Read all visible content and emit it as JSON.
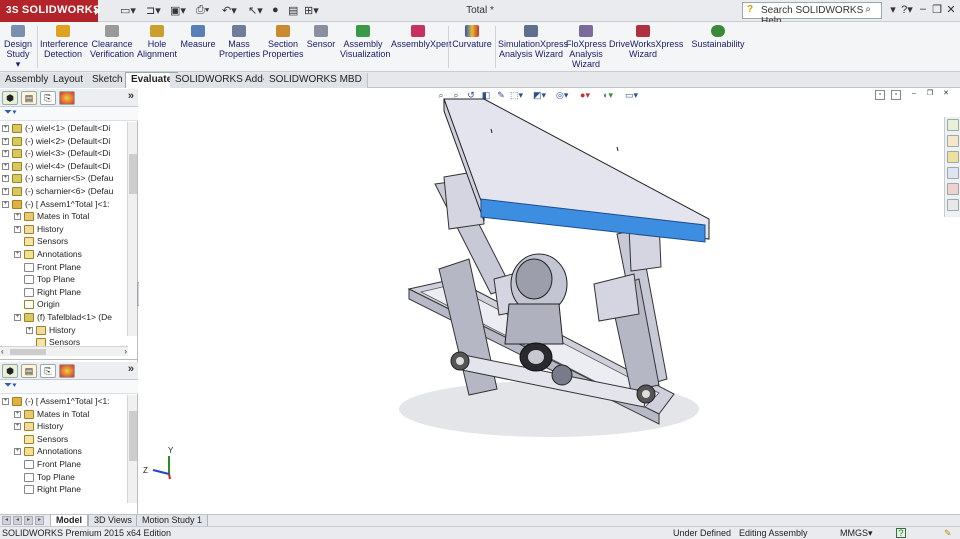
{
  "titlebar": {
    "app_name": "SOLIDWORKS",
    "brand_prefix": "3S",
    "document_title": "Total *",
    "search_placeholder": "Search SOLIDWORKS Help",
    "brand_color": "#b3242a"
  },
  "ribbon": {
    "items": [
      {
        "label": "Design Study",
        "icon": "design-study-icon"
      },
      {
        "label": "Interference Detection",
        "icon": "interference-detection-icon"
      },
      {
        "label": "Clearance Verification",
        "icon": "clearance-verification-icon"
      },
      {
        "label": "Hole Alignment",
        "icon": "hole-alignment-icon"
      },
      {
        "label": "Measure",
        "icon": "measure-icon"
      },
      {
        "label": "Mass Properties",
        "icon": "mass-properties-icon"
      },
      {
        "label": "Section Properties",
        "icon": "section-properties-icon"
      },
      {
        "label": "Sensor",
        "icon": "sensor-icon"
      },
      {
        "label": "Assembly Visualization",
        "icon": "assembly-visualization-icon"
      },
      {
        "label": "AssemblyXpert",
        "icon": "assemblyxpert-icon"
      },
      {
        "label": "Curvature",
        "icon": "curvature-icon"
      },
      {
        "label": "SimulationXpress Analysis Wizard",
        "icon": "simulationxpress-icon"
      },
      {
        "label": "FloXpress Analysis Wizard",
        "icon": "floxpress-icon"
      },
      {
        "label": "DriveWorksXpress Wizard",
        "icon": "driveworksxpress-icon"
      },
      {
        "label": "Sustainability",
        "icon": "sustainability-icon"
      }
    ]
  },
  "command_tabs": [
    "Assembly",
    "Layout",
    "Sketch",
    "Evaluate",
    "SOLIDWORKS Add-Ins",
    "SOLIDWORKS MBD"
  ],
  "active_command_tab": "Evaluate",
  "tree_top": {
    "rows": [
      {
        "label": "(-) wiel<1> (Default<Di",
        "type": "part"
      },
      {
        "label": "(-) wiel<2> (Default<Di",
        "type": "part"
      },
      {
        "label": "(-) wiel<3> (Default<Di",
        "type": "part"
      },
      {
        "label": "(-) wiel<4> (Default<Di",
        "type": "part"
      },
      {
        "label": "(-) scharnier<5> (Defau",
        "type": "part"
      },
      {
        "label": "(-) scharnier<6> (Defau",
        "type": "part"
      },
      {
        "label": "(-) [ Assem1^Total ]<1:",
        "type": "assembly"
      },
      {
        "label": "Mates in Total",
        "type": "mates"
      },
      {
        "label": "History",
        "type": "history"
      },
      {
        "label": "Sensors",
        "type": "sensors"
      },
      {
        "label": "Annotations",
        "type": "annotations"
      },
      {
        "label": "Front Plane",
        "type": "plane"
      },
      {
        "label": "Top Plane",
        "type": "plane"
      },
      {
        "label": "Right Plane",
        "type": "plane"
      },
      {
        "label": "Origin",
        "type": "origin"
      },
      {
        "label": "(f) Tafelblad<1> (De",
        "type": "part"
      },
      {
        "label": "History",
        "type": "history"
      },
      {
        "label": "Sensors",
        "type": "sensors"
      }
    ]
  },
  "tree_bottom": {
    "rows": [
      {
        "label": "(-) [ Assem1^Total ]<1:",
        "type": "assembly"
      },
      {
        "label": "Mates in Total",
        "type": "mates"
      },
      {
        "label": "History",
        "type": "history"
      },
      {
        "label": "Sensors",
        "type": "sensors"
      },
      {
        "label": "Annotations",
        "type": "annotations"
      },
      {
        "label": "Front Plane",
        "type": "plane"
      },
      {
        "label": "Top Plane",
        "type": "plane"
      },
      {
        "label": "Right Plane",
        "type": "plane"
      }
    ]
  },
  "triad": {
    "x": "X",
    "y": "Y",
    "z": "Z"
  },
  "bottom_tabs": [
    "Model",
    "3D Views",
    "Motion Study 1"
  ],
  "active_bottom_tab": "Model",
  "statusbar": {
    "edition": "SOLIDWORKS Premium 2015 x64 Edition",
    "definition": "Under Defined",
    "mode": "Editing Assembly",
    "units": "MMGS",
    "help": "?"
  },
  "colors": {
    "selected_face": "#3d8de0",
    "part_face": "#d8d9e6"
  }
}
